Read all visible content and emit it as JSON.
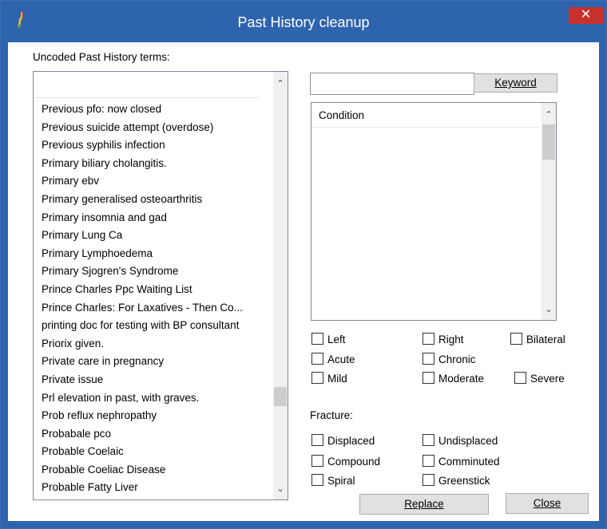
{
  "window": {
    "title": "Past History cleanup",
    "close_glyph": "✕",
    "accent_color": "#2e63ad",
    "close_color": "#c7302b"
  },
  "uncoded_label": "Uncoded Past History terms:",
  "list": {
    "items": [
      "Previous pfo: now closed",
      "Previous suicide attempt (overdose)",
      "Previous syphilis infection",
      "Primary biliary cholangitis.",
      "Primary ebv",
      "Primary generalised osteoarthritis",
      "Primary insomnia and gad",
      "Primary Lung Ca",
      "Primary Lymphoedema",
      "Primary Sjogren's Syndrome",
      "Prince Charles Ppc Waiting List",
      "Prince Charles:  For Laxatives - Then Co...",
      "printing doc for testing with BP consultant",
      "Priorix given.",
      "Private care in pregnancy",
      "Private issue",
      "Prl elevation in past, with graves.",
      "Prob reflux nephropathy",
      "Probabale pco",
      "Probable Coelaic",
      "Probable Coeliac Disease",
      "Probable Fatty Liver"
    ]
  },
  "search": {
    "value": "",
    "keyword_label": "Keyword"
  },
  "conditions": {
    "header": "Condition"
  },
  "modifiers": {
    "left": "Left",
    "right": "Right",
    "bilateral": "Bilateral",
    "acute": "Acute",
    "chronic": "Chronic",
    "mild": "Mild",
    "moderate": "Moderate",
    "severe": "Severe"
  },
  "fracture": {
    "label": "Fracture:",
    "displaced": "Displaced",
    "undisplaced": "Undisplaced",
    "compound": "Compound",
    "comminuted": "Comminuted",
    "spiral": "Spiral",
    "greenstick": "Greenstick"
  },
  "buttons": {
    "replace": "Replace",
    "close": "Close"
  },
  "icons": {
    "scroll_up": "chevron-up-icon",
    "scroll_down": "chevron-down-icon"
  }
}
